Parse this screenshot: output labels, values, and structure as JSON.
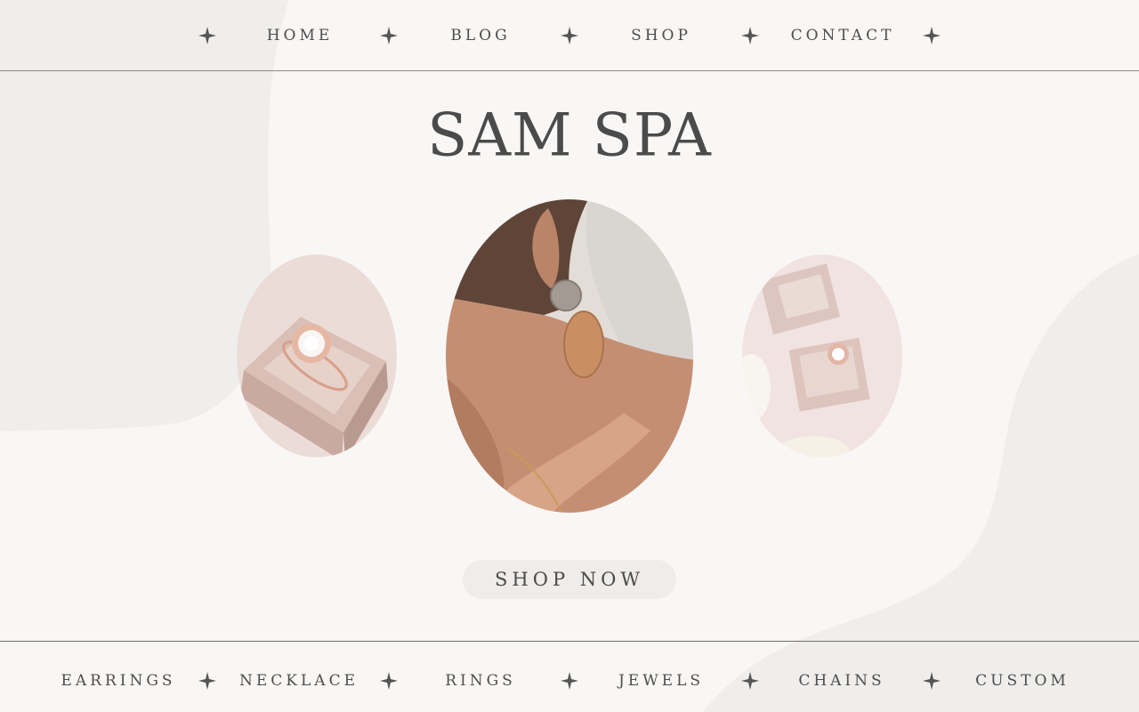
{
  "nav": {
    "items": [
      {
        "label": "HOME"
      },
      {
        "label": "BLOG"
      },
      {
        "label": "SHOP"
      },
      {
        "label": "CONTACT"
      }
    ],
    "separator_icon": "four-point-star-icon"
  },
  "hero": {
    "brand": "SAM SPA",
    "images": [
      {
        "subject": "ring-in-box-photo"
      },
      {
        "subject": "earring-model-photo"
      },
      {
        "subject": "ring-boxes-photo"
      }
    ],
    "cta_label": "SHOP NOW"
  },
  "categories": {
    "items": [
      {
        "label": "EARRINGS"
      },
      {
        "label": "NECKLACE"
      },
      {
        "label": "RINGS"
      },
      {
        "label": "JEWELS"
      },
      {
        "label": "CHAINS"
      },
      {
        "label": "CUSTOM"
      }
    ],
    "separator_icon": "four-point-star-icon"
  },
  "colors": {
    "background": "#f9f7f5",
    "blob": "#efeeed",
    "text": "#4a4a4a",
    "button": "#efedeb"
  }
}
